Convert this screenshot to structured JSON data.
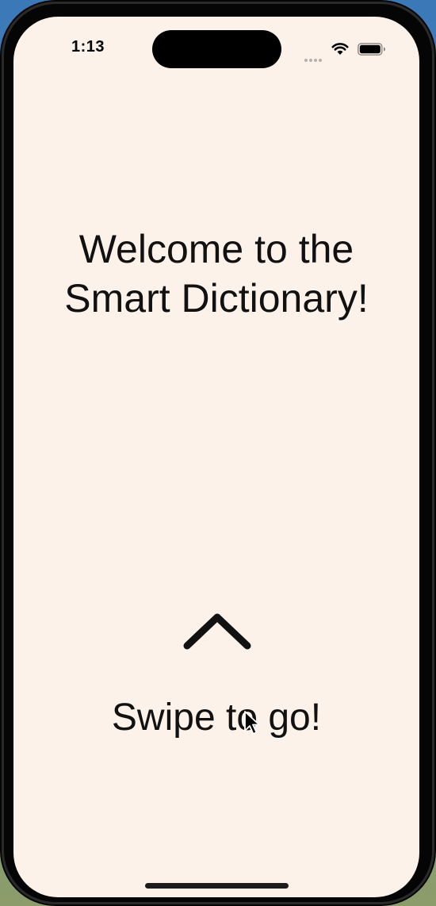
{
  "status_bar": {
    "time": "1:13",
    "icons": [
      "cellular-dots-icon",
      "wifi-icon",
      "battery-icon"
    ]
  },
  "onboarding": {
    "title_line1": "Welcome to the",
    "title_line2": "Smart Dictionary!",
    "swipe_icon": "chevron-up-icon",
    "swipe_label": "Swipe to go!"
  },
  "colors": {
    "screen_background": "#fdf2ea",
    "text": "#111111"
  }
}
